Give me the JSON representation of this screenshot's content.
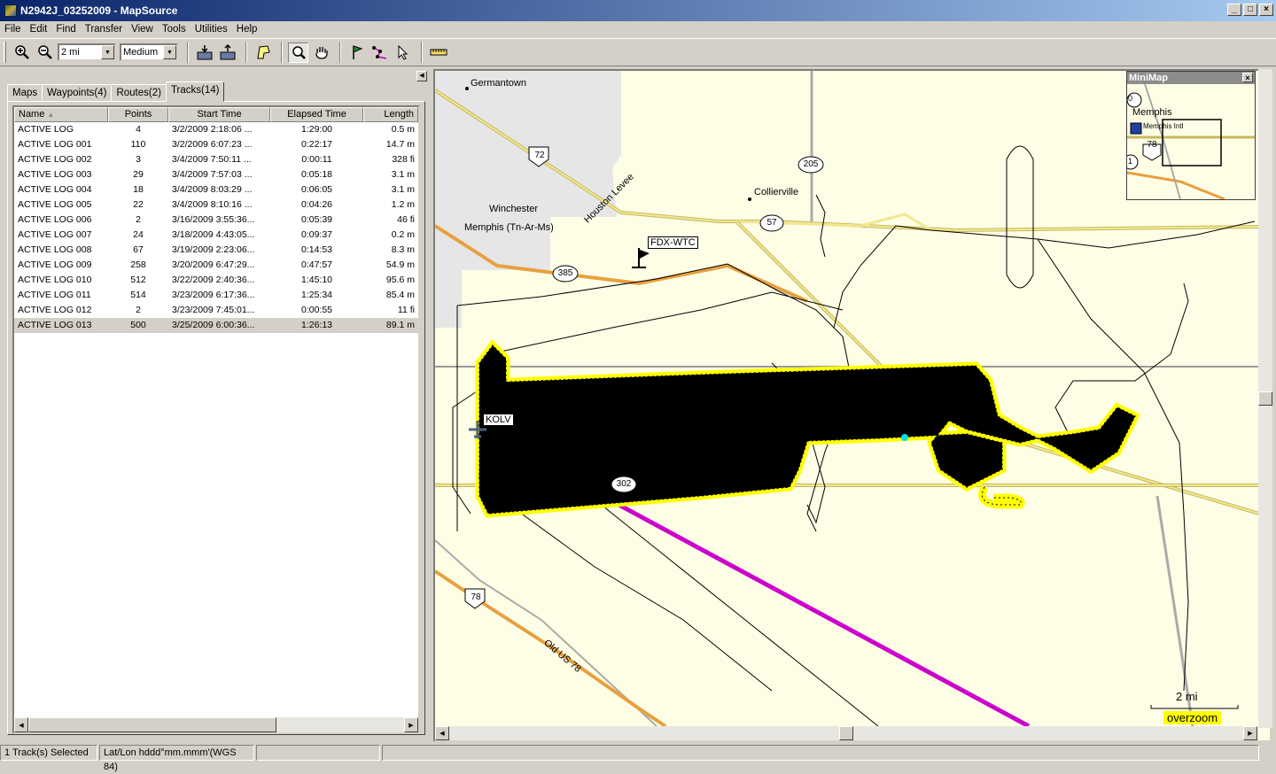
{
  "window": {
    "title": "N2942J_03252009 - MapSource"
  },
  "menu": [
    "File",
    "Edit",
    "Find",
    "Transfer",
    "View",
    "Tools",
    "Utilities",
    "Help"
  ],
  "toolbar": {
    "zoom_value": "2 mi",
    "detail_value": "Medium"
  },
  "tabs": [
    {
      "label": "Maps"
    },
    {
      "label": "Waypoints(4)"
    },
    {
      "label": "Routes(2)"
    },
    {
      "label": "Tracks(14)",
      "active": true
    }
  ],
  "table": {
    "columns": [
      "Name",
      "Points",
      "Start Time",
      "Elapsed Time",
      "Length"
    ],
    "rows": [
      [
        "ACTIVE LOG",
        "4",
        "3/2/2009 2:18:06 ...",
        "1:29:00",
        "0.5 m"
      ],
      [
        "ACTIVE LOG 001",
        "110",
        "3/2/2009 6:07:23 ...",
        "0:22:17",
        "14.7 m"
      ],
      [
        "ACTIVE LOG 002",
        "3",
        "3/4/2009 7:50:11 ...",
        "0:00:11",
        "328 fi"
      ],
      [
        "ACTIVE LOG 003",
        "29",
        "3/4/2009 7:57:03 ...",
        "0:05:18",
        "3.1 m"
      ],
      [
        "ACTIVE LOG 004",
        "18",
        "3/4/2009 8:03:29 ...",
        "0:06:05",
        "3.1 m"
      ],
      [
        "ACTIVE LOG 005",
        "22",
        "3/4/2009 8:10:16 ...",
        "0:04:26",
        "1.2 m"
      ],
      [
        "ACTIVE LOG 006",
        "2",
        "3/16/2009 3:55:36...",
        "0:05:39",
        "46 fi"
      ],
      [
        "ACTIVE LOG 007",
        "24",
        "3/18/2009 4:43:05...",
        "0:09:37",
        "0.2 m"
      ],
      [
        "ACTIVE LOG 008",
        "67",
        "3/19/2009 2:23:06...",
        "0:14:53",
        "8.3 m"
      ],
      [
        "ACTIVE LOG 009",
        "258",
        "3/20/2009 6:47:29...",
        "0:47:57",
        "54.9 m"
      ],
      [
        "ACTIVE LOG 010",
        "512",
        "3/22/2009 2:40:36...",
        "1:45:10",
        "95.6 m"
      ],
      [
        "ACTIVE LOG 011",
        "514",
        "3/23/2009 6:17:36...",
        "1:25:34",
        "85.4 m"
      ],
      [
        "ACTIVE LOG 012",
        "2",
        "3/23/2009 7:45:01...",
        "0:00:55",
        "11 fi"
      ],
      [
        "ACTIVE LOG 013",
        "500",
        "3/25/2009 6:00:36...",
        "1:26:13",
        "89.1 m"
      ]
    ],
    "selected_row": 13
  },
  "map": {
    "labels": {
      "germantown": "Germantown",
      "collierville": "Collierville",
      "winchester": "Winchester",
      "memphis_tn": "Memphis (Tn-Ar-Ms)",
      "houston_levee": "Houston Levee",
      "old_us78": "Old US 78"
    },
    "shields": {
      "r72": "72",
      "r205": "205",
      "r57": "57",
      "r385": "385",
      "r302": "302",
      "r78": "78"
    },
    "waypoints": {
      "fdx": "FDX-WTC",
      "kolv": "KOLV"
    },
    "scale_label": "2 mi",
    "overzoom_label": "overzoom",
    "colors": {
      "track": "#000000",
      "highlight": "#ffff00",
      "route": "#cc00cc",
      "highway": "#e8a040",
      "road": "#d8c870",
      "urban": "#e6e6e6",
      "land": "#fefee6"
    }
  },
  "minimap": {
    "title": "MiniMap",
    "memphis": "Memphis",
    "memphis_intl": "Memphis Intl",
    "shield": "78",
    "partial_a": "0",
    "partial_b": "1"
  },
  "status": {
    "selection": "1 Track(s) Selected",
    "coord_format": "Lat/Lon hddd°mm.mmm'(WGS 84)"
  }
}
